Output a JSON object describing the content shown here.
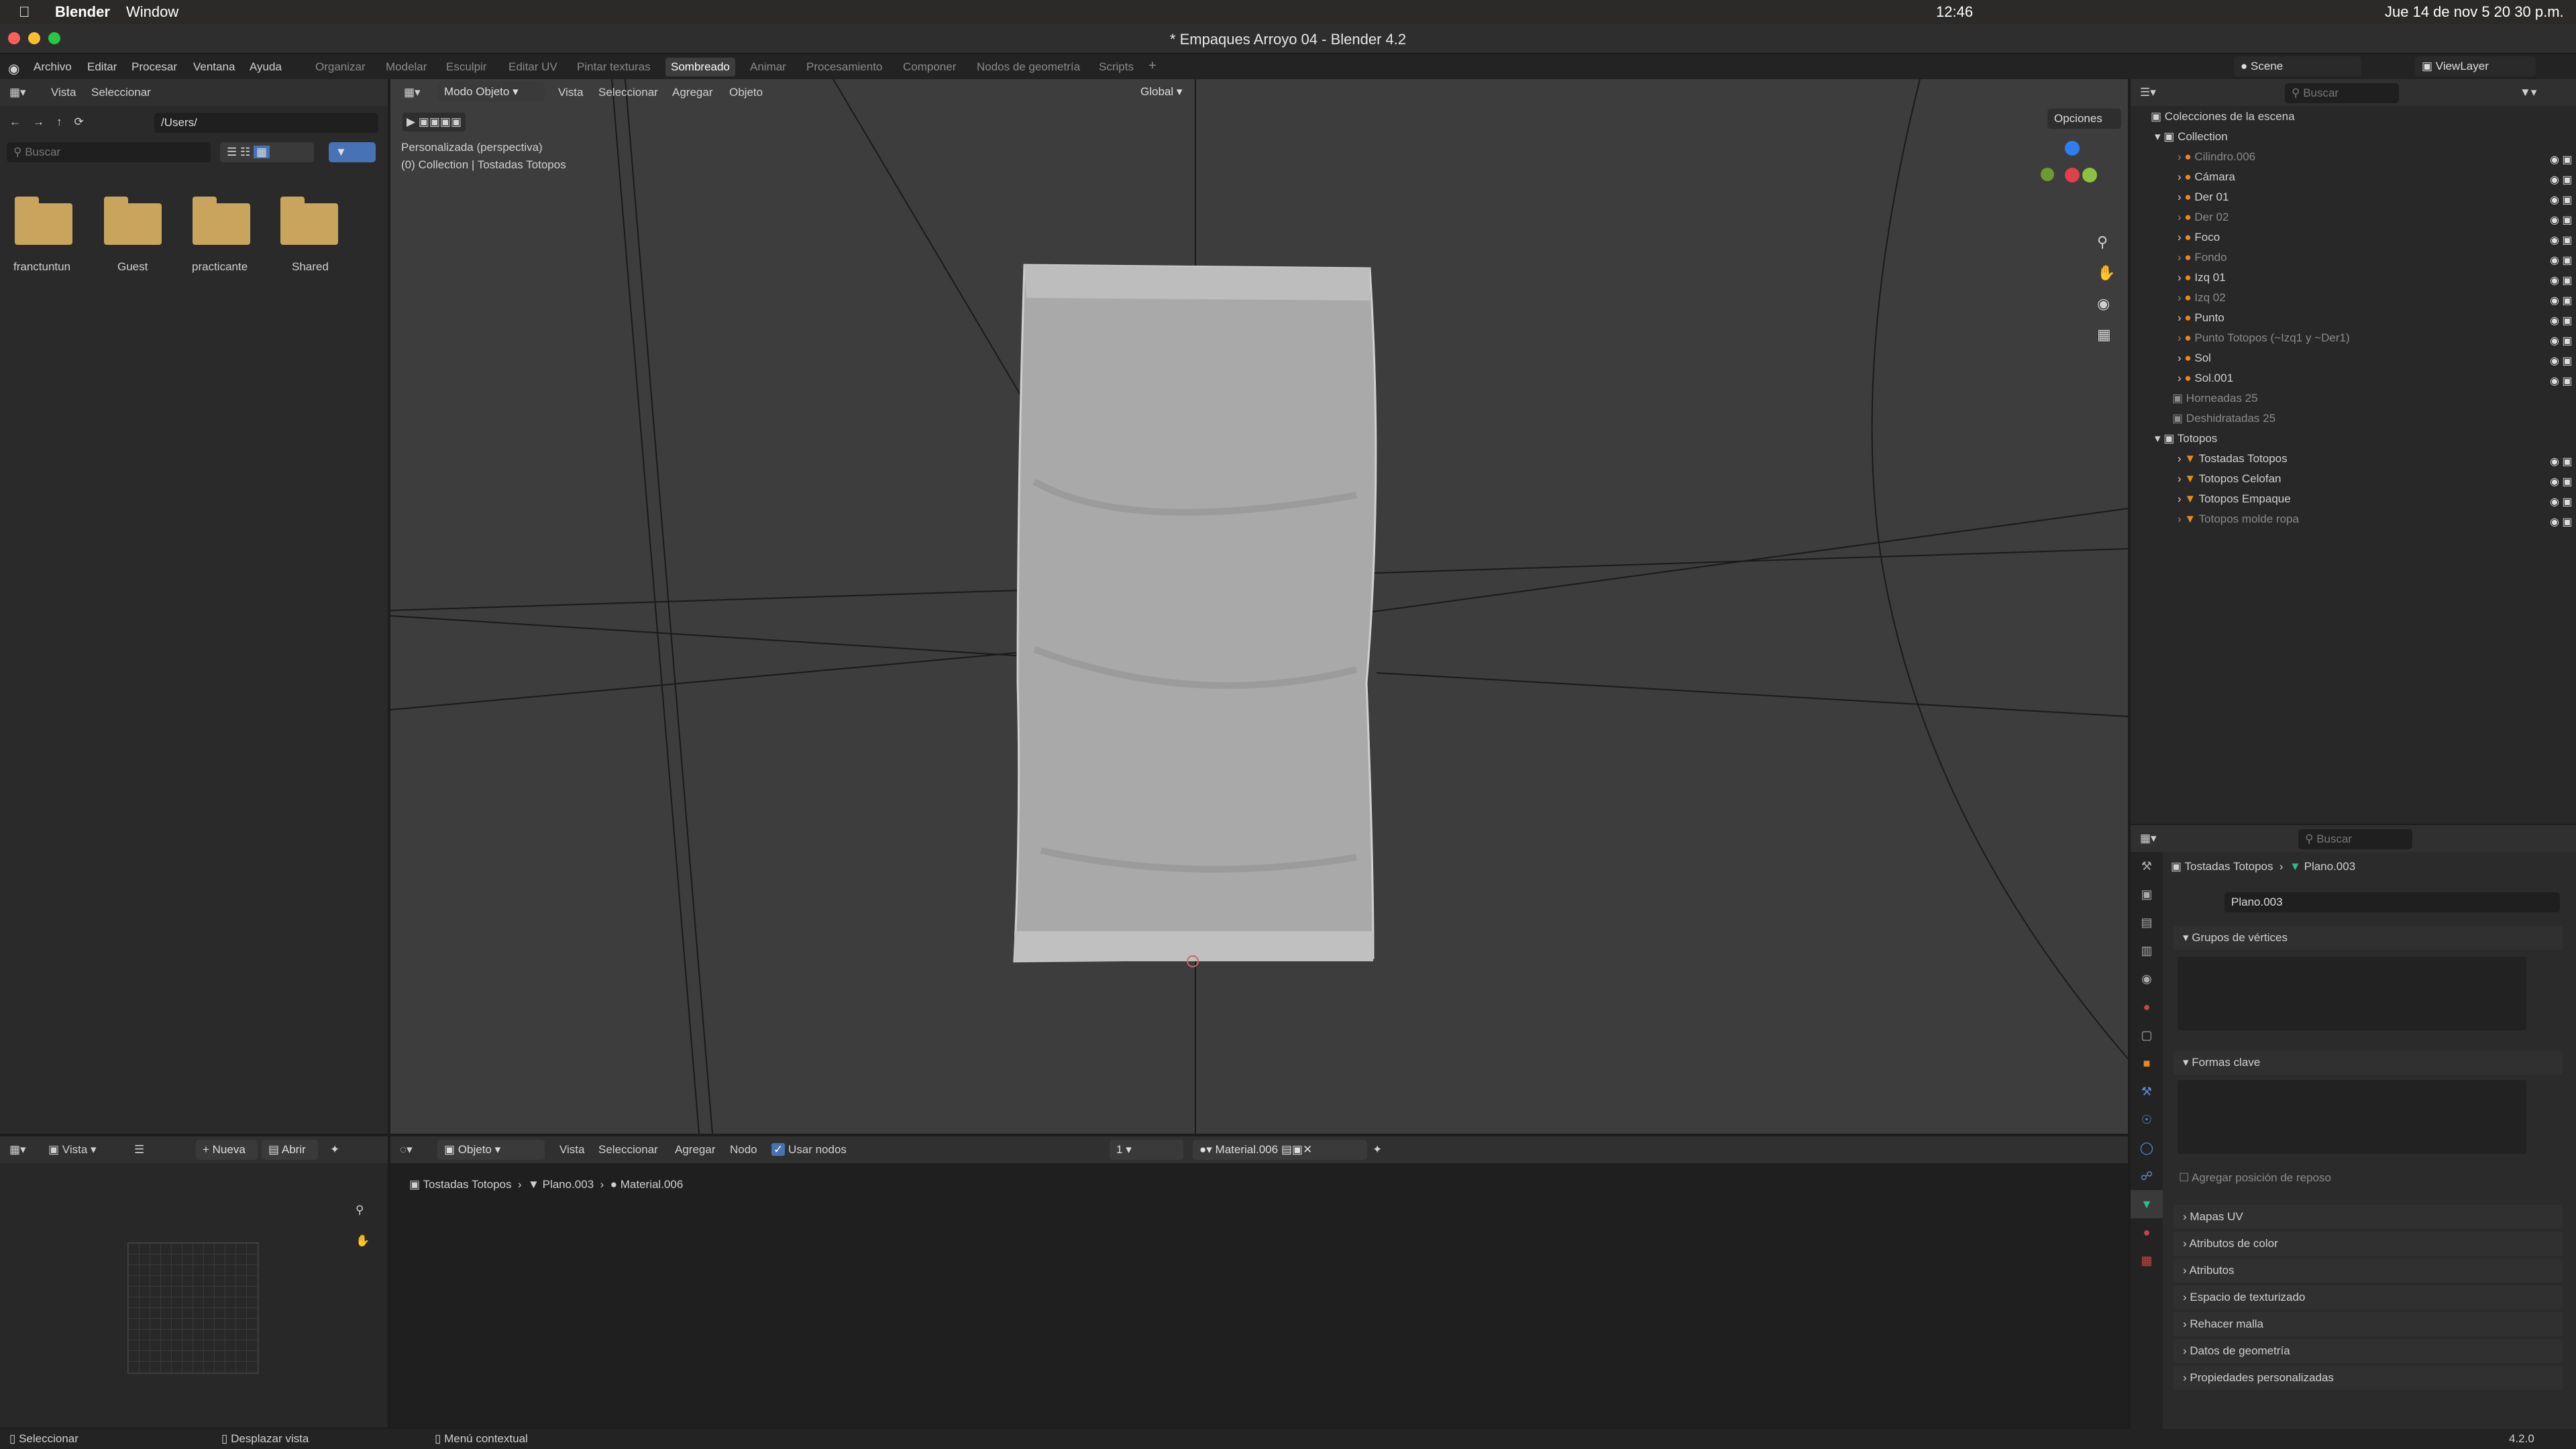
{
  "macbar": {
    "app": "Blender",
    "menu_window": "Window",
    "time": "12:46",
    "date": "Jue 14 de nov 5 20 30 p.m."
  },
  "window": {
    "title": "* Empaques Arroyo 04 - Blender 4.2"
  },
  "menu": {
    "items": [
      "Archivo",
      "Editar",
      "Procesar",
      "Ventana",
      "Ayuda"
    ]
  },
  "workspaces": {
    "tabs": [
      "Organizar",
      "Modelar",
      "Esculpir",
      "Editar UV",
      "Pintar texturas",
      "Sombreado",
      "Animar",
      "Procesamiento",
      "Componer",
      "Nodos de geometría",
      "Scripts"
    ],
    "active": "Sombreado",
    "add": "+"
  },
  "scene": {
    "name": "Scene",
    "view_layer": "ViewLayer"
  },
  "filebrowser": {
    "menu_vista": "Vista",
    "menu_seleccionar": "Seleccionar",
    "path": "/Users/",
    "search_placeholder": "Buscar",
    "folders": [
      "franctuntun",
      "Guest",
      "practicante",
      "Shared"
    ]
  },
  "viewport": {
    "mode": "Modo Objeto",
    "menus": [
      "Vista",
      "Seleccionar",
      "Agregar",
      "Objeto"
    ],
    "orientation": "Global",
    "options": "Opciones",
    "info_line1": "Personalizada (perspectiva)",
    "info_line2": "(0) Collection | Tostadas Totopos"
  },
  "outliner": {
    "search_placeholder": "Buscar",
    "root": "Colecciones de la escena",
    "collection": "Collection",
    "items": [
      {
        "name": "Cilindro.006",
        "dim": true
      },
      {
        "name": "Cámara",
        "dim": false
      },
      {
        "name": "Der 01",
        "dim": false
      },
      {
        "name": "Der 02",
        "dim": true
      },
      {
        "name": "Foco",
        "dim": false
      },
      {
        "name": "Fondo",
        "dim": true
      },
      {
        "name": "Izq 01",
        "dim": false
      },
      {
        "name": "Izq 02",
        "dim": true
      },
      {
        "name": "Punto",
        "dim": false
      },
      {
        "name": "Punto Totopos (~Izq1 y ~Der1)",
        "dim": true
      },
      {
        "name": "Sol",
        "dim": false
      },
      {
        "name": "Sol.001",
        "dim": false
      }
    ],
    "coll2": "Horneadas 25",
    "coll3": "Deshidratadas 25",
    "coll4": "Totopos",
    "totopos_items": [
      {
        "name": "Tostadas Totopos",
        "dim": false
      },
      {
        "name": "Totopos Celofan",
        "dim": false
      },
      {
        "name": "Totopos Empaque",
        "dim": false
      },
      {
        "name": "Totopos molde ropa",
        "dim": true
      }
    ]
  },
  "properties": {
    "search_placeholder": "Buscar",
    "breadcrumb_object": "Tostadas Totopos",
    "breadcrumb_mesh": "Plano.003",
    "mesh_name": "Plano.003",
    "vertex_groups": "Grupos de vértices",
    "shape_keys": "Formas clave",
    "rest_position": "Agregar posición de reposo",
    "sections": [
      "Mapas UV",
      "Atributos de color",
      "Atributos",
      "Espacio de texturizado",
      "Rehacer malla",
      "Datos de geometría",
      "Propiedades personalizadas"
    ]
  },
  "image_editor": {
    "menu_vista": "Vista",
    "new": "Nueva",
    "open": "Abrir"
  },
  "node_editor": {
    "type": "Objeto",
    "menus": [
      "Vista",
      "Seleccionar",
      "Agregar",
      "Nodo"
    ],
    "use_nodes": "Usar nodos",
    "slot": "1",
    "material": "Material.006",
    "crumb_object": "Tostadas Totopos",
    "crumb_mesh": "Plano.003",
    "crumb_material": "Material.006"
  },
  "statusbar": {
    "select": "Seleccionar",
    "pan": "Desplazar vista",
    "context": "Menú contextual",
    "version": "4.2.0"
  }
}
